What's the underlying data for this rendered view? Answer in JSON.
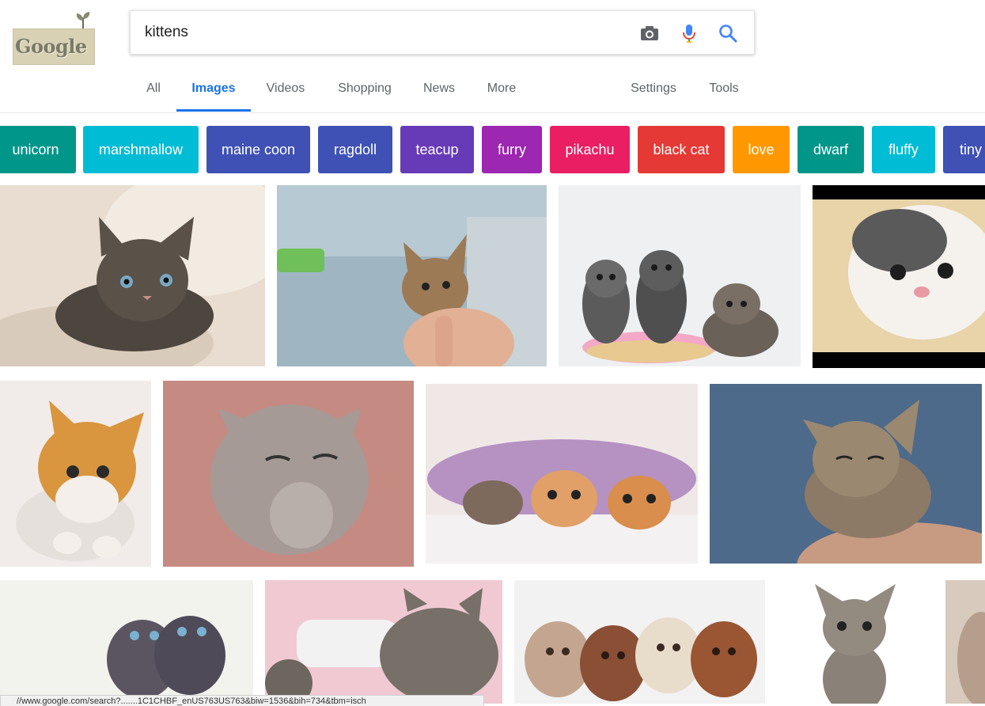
{
  "logo": {
    "text": "Google"
  },
  "search": {
    "query": "kittens"
  },
  "tabs": [
    {
      "label": "All"
    },
    {
      "label": "Images"
    },
    {
      "label": "Videos"
    },
    {
      "label": "Shopping"
    },
    {
      "label": "News"
    },
    {
      "label": "More"
    },
    {
      "label": "Settings"
    },
    {
      "label": "Tools"
    }
  ],
  "active_tab": "Images",
  "chips": [
    {
      "label": "unicorn",
      "color": "#00968a"
    },
    {
      "label": "marshmallow",
      "color": "#00bcd4"
    },
    {
      "label": "maine coon",
      "color": "#3f51b5"
    },
    {
      "label": "ragdoll",
      "color": "#3f51b5"
    },
    {
      "label": "teacup",
      "color": "#673ab7"
    },
    {
      "label": "furry",
      "color": "#9c27b0"
    },
    {
      "label": "pikachu",
      "color": "#e91e63"
    },
    {
      "label": "black cat",
      "color": "#e53935"
    },
    {
      "label": "love",
      "color": "#ff9800"
    },
    {
      "label": "dwarf",
      "color": "#00968a"
    },
    {
      "label": "fluffy",
      "color": "#00bcd4"
    },
    {
      "label": "tiny",
      "color": "#3f51b5"
    }
  ],
  "results": [
    {
      "subject": "tabby kitten lying on fluffy rug"
    },
    {
      "subject": "tiny tabby kitten held in hand"
    },
    {
      "subject": "three kittens on pink donut cushion"
    },
    {
      "subject": "white and grey kitten close-up"
    },
    {
      "subject": "orange and white kitten"
    },
    {
      "subject": "grey fluffy kitten with paws"
    },
    {
      "subject": "three kittens under a blanket"
    },
    {
      "subject": "tabby kitten resting on arm"
    },
    {
      "subject": "two maine coon kittens"
    },
    {
      "subject": "kitten drinking from bottle"
    },
    {
      "subject": "four fluffy kittens in a row"
    },
    {
      "subject": "tabby kitten sitting"
    },
    {
      "subject": "partial kitten image"
    }
  ],
  "status": {
    "url": "//www.google.com/search?.......1C1CHBF_enUS763US763&biw=1536&bih=734&tbm=isch"
  }
}
